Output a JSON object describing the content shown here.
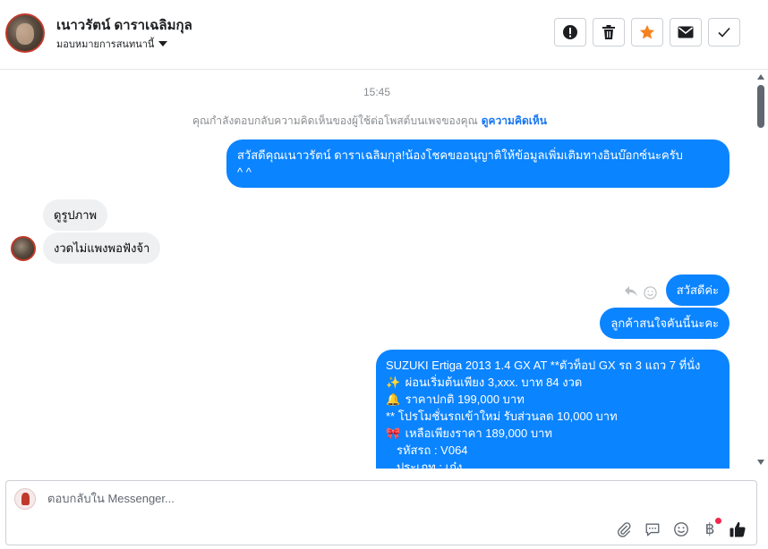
{
  "header": {
    "contact_name": "เนาวรัตน์ ดาราเฉลิมกุล",
    "assign_label": "มอบหมายการสนทนานี้",
    "buttons": {
      "alert": "alert-icon",
      "delete": "trash-icon",
      "star": "star-icon",
      "mail": "mail-icon",
      "done": "check-icon"
    },
    "star_color": "#f5821f"
  },
  "conversation": {
    "timestamp": "15:45",
    "notice_text": "คุณกำลังตอบกลับความคิดเห็นของผู้ใช้ต่อโพสต์บนเพจของคุณ",
    "notice_link": "ดูความคิดเห็น",
    "messages": [
      {
        "direction": "out",
        "lines": [
          "สวัสดีคุณเนาวรัตน์ ดาราเฉลิมกุล!น้องโชคขออนุญาติให้ข้อมูลเพิ่มเติมทางอินบ๊อกซ์นะครับ",
          "^ ^"
        ]
      },
      {
        "direction": "in",
        "text": "ดูรูปภาพ"
      },
      {
        "direction": "in",
        "text": "งวดไม่แพงพอฟังจ้า"
      },
      {
        "direction": "out",
        "text": "สวัสดีค่ะ"
      },
      {
        "direction": "out",
        "text": "ลูกค้าสนใจคันนี้นะคะ"
      },
      {
        "direction": "out",
        "lines": [
          "SUZUKI Ertiga 2013 1.4 GX AT **ตัวท็อป GX รถ 3 แถว 7 ที่นั่ง",
          "ผ่อนเริ่มต้นเพียง 3,xxx. บาท 84 งวด",
          "ราคาปกติ 199,000 บาท",
          "** โปรโมชั่นรถเข้าใหม่ รับส่วนลด 10,000 บาท",
          "เหลือเพียงราคา 189,000 บาท",
          "รหัสรถ : V064",
          "ประเภท : เก๋ง"
        ],
        "line_emoji": [
          "",
          "✨",
          "🔔",
          "",
          "🎀",
          "",
          ""
        ]
      }
    ],
    "out_bubble_color": "#0b84ff",
    "in_bubble_color": "#eef0f2"
  },
  "composer": {
    "placeholder": "ตอบกลับใน Messenger...",
    "tools": [
      "paperclip-icon",
      "saved-reply-icon",
      "emoji-icon",
      "baht-icon",
      "like-icon"
    ],
    "baht_symbol": "฿"
  }
}
